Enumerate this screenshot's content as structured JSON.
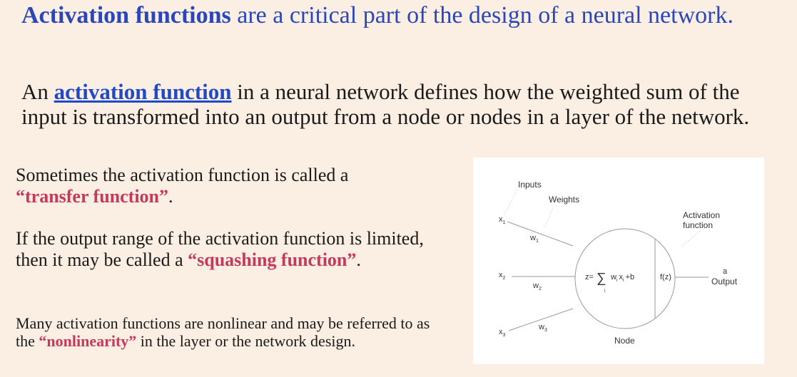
{
  "heading": {
    "bold": "Activation functions",
    "rest": " are a critical part of the design of a neural network."
  },
  "definition": {
    "prefix": "An ",
    "link": "activation function",
    "suffix": " in a neural network defines how the weighted sum of the input is transformed into an output from a node or nodes in a layer of the network."
  },
  "note1": {
    "text": "Sometimes the activation function is called a ",
    "highlight": "“transfer function”",
    "end": "."
  },
  "note2": {
    "text": "If the output range of the activation function is limited, then it may be called a ",
    "highlight": "“squashing function”",
    "end": "."
  },
  "note3": {
    "text": "Many activation functions are nonlinear and may be referred to as the ",
    "highlight": "“nonlinearity”",
    "end": " in the layer or the network design."
  },
  "diagram": {
    "inputs_label": "Inputs",
    "weights_label": "Weights",
    "activation_label_1": "Activation",
    "activation_label_2": "function",
    "x1": "x",
    "x1_sub": "1",
    "x2": "x",
    "x2_sub": "2",
    "x3": "x",
    "x3_sub": "3",
    "w1": "w",
    "w1_sub": "1",
    "w2": "w",
    "w2_sub": "2",
    "w3": "w",
    "w3_sub": "3",
    "formula_prefix": "z=",
    "sigma": "∑",
    "sigma_sub": "i",
    "formula_w": "w",
    "formula_w_sub": "i",
    "formula_x": "x",
    "formula_x_sub": "i",
    "formula_suffix": "+b",
    "fz": "f(z)",
    "output_a": "a",
    "output_label": "Output",
    "node_label": "Node"
  }
}
